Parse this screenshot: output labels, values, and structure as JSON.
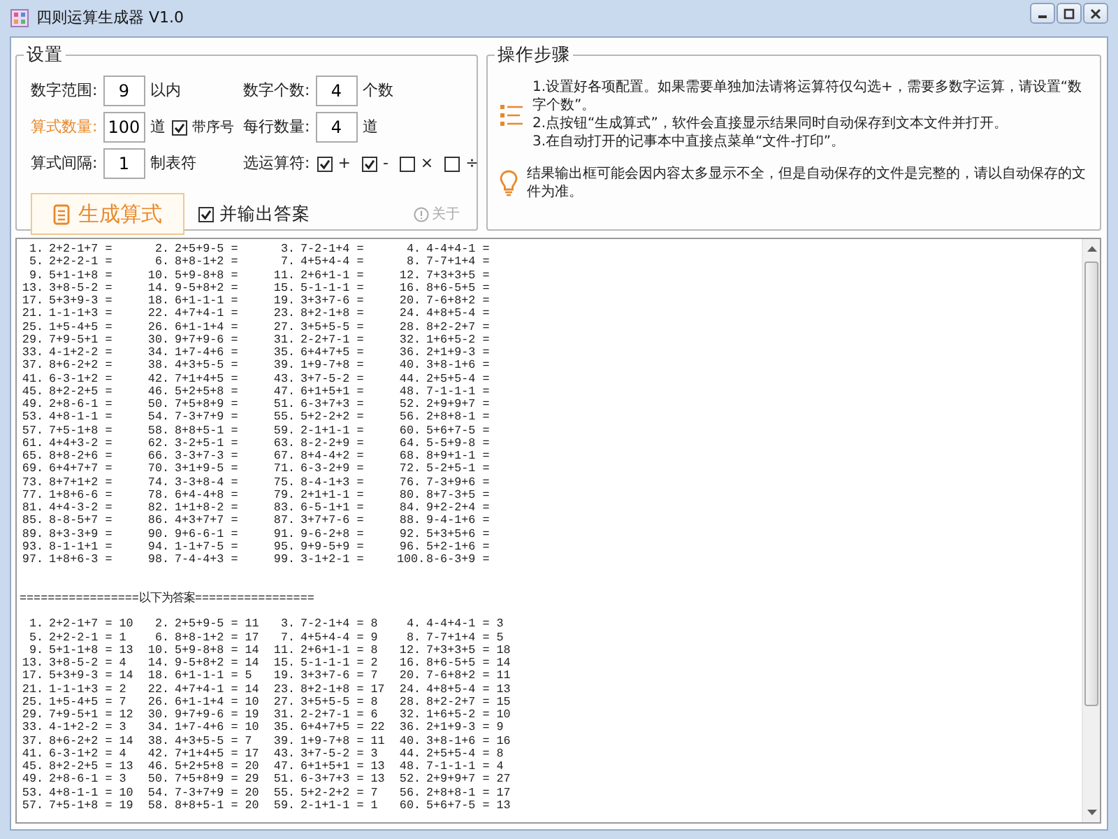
{
  "window": {
    "title": "四则运算生成器 V1.0"
  },
  "settings": {
    "title": "设置",
    "fields": [
      {
        "kind": "number",
        "label": "数字范围:",
        "value": "9",
        "unit": "以内",
        "highlighted": false
      },
      {
        "kind": "number",
        "label": "数字个数:",
        "value": "4",
        "unit": "个数",
        "highlighted": false
      },
      {
        "kind": "number",
        "label": "算式数量:",
        "value": "100",
        "unit": "道",
        "highlighted": true,
        "checkbox": {
          "label": "带序号",
          "checked": true
        }
      },
      {
        "kind": "number",
        "label": "每行数量:",
        "value": "4",
        "unit": "道",
        "highlighted": false
      },
      {
        "kind": "number",
        "label": "算式间隔:",
        "value": "1",
        "unit": "制表符",
        "highlighted": false
      },
      {
        "kind": "operators",
        "label": "选运算符:",
        "highlighted": false,
        "options": [
          {
            "symbol": "+",
            "checked": true
          },
          {
            "symbol": "-",
            "checked": true
          },
          {
            "symbol": "×",
            "checked": false
          },
          {
            "symbol": "÷",
            "checked": false
          }
        ]
      }
    ],
    "generate_button": "生成算式",
    "output_answers": {
      "label": "并输出答案",
      "checked": true
    },
    "about": "关于"
  },
  "steps": {
    "title": "操作步骤",
    "items": [
      "1.设置好各项配置。如果需要单独加法请将运算符仅勾选+，需要多数字运算，请设置“数字个数”。",
      "2.点按钮“生成算式”，软件会直接显示结果同时自动保存到文本文件并打开。",
      "3.在自动打开的记事本中直接点菜单“文件-打印”。"
    ],
    "tip": "结果输出框可能会因内容太多显示不全，但是自动保存的文件是完整的，请以自动保存的文件为准。"
  },
  "output": {
    "problems": [
      {
        "number": "1.",
        "expression": "2+2-1+7 ="
      },
      {
        "number": "2.",
        "expression": "2+5+9-5 ="
      },
      {
        "number": "3.",
        "expression": "7-2-1+4 ="
      },
      {
        "number": "4.",
        "expression": "4-4+4-1 ="
      },
      {
        "number": "5.",
        "expression": "2+2-2-1 ="
      },
      {
        "number": "6.",
        "expression": "8+8-1+2 ="
      },
      {
        "number": "7.",
        "expression": "4+5+4-4 ="
      },
      {
        "number": "8.",
        "expression": "7-7+1+4 ="
      },
      {
        "number": "9.",
        "expression": "5+1-1+8 ="
      },
      {
        "number": "10.",
        "expression": "5+9-8+8 ="
      },
      {
        "number": "11.",
        "expression": "2+6+1-1 ="
      },
      {
        "number": "12.",
        "expression": "7+3+3+5 ="
      },
      {
        "number": "13.",
        "expression": "3+8-5-2 ="
      },
      {
        "number": "14.",
        "expression": "9-5+8+2 ="
      },
      {
        "number": "15.",
        "expression": "5-1-1-1 ="
      },
      {
        "number": "16.",
        "expression": "8+6-5+5 ="
      },
      {
        "number": "17.",
        "expression": "5+3+9-3 ="
      },
      {
        "number": "18.",
        "expression": "6+1-1-1 ="
      },
      {
        "number": "19.",
        "expression": "3+3+7-6 ="
      },
      {
        "number": "20.",
        "expression": "7-6+8+2 ="
      },
      {
        "number": "21.",
        "expression": "1-1-1+3 ="
      },
      {
        "number": "22.",
        "expression": "4+7+4-1 ="
      },
      {
        "number": "23.",
        "expression": "8+2-1+8 ="
      },
      {
        "number": "24.",
        "expression": "4+8+5-4 ="
      },
      {
        "number": "25.",
        "expression": "1+5-4+5 ="
      },
      {
        "number": "26.",
        "expression": "6+1-1+4 ="
      },
      {
        "number": "27.",
        "expression": "3+5+5-5 ="
      },
      {
        "number": "28.",
        "expression": "8+2-2+7 ="
      },
      {
        "number": "29.",
        "expression": "7+9-5+1 ="
      },
      {
        "number": "30.",
        "expression": "9+7+9-6 ="
      },
      {
        "number": "31.",
        "expression": "2-2+7-1 ="
      },
      {
        "number": "32.",
        "expression": "1+6+5-2 ="
      },
      {
        "number": "33.",
        "expression": "4-1+2-2 ="
      },
      {
        "number": "34.",
        "expression": "1+7-4+6 ="
      },
      {
        "number": "35.",
        "expression": "6+4+7+5 ="
      },
      {
        "number": "36.",
        "expression": "2+1+9-3 ="
      },
      {
        "number": "37.",
        "expression": "8+6-2+2 ="
      },
      {
        "number": "38.",
        "expression": "4+3+5-5 ="
      },
      {
        "number": "39.",
        "expression": "1+9-7+8 ="
      },
      {
        "number": "40.",
        "expression": "3+8-1+6 ="
      },
      {
        "number": "41.",
        "expression": "6-3-1+2 ="
      },
      {
        "number": "42.",
        "expression": "7+1+4+5 ="
      },
      {
        "number": "43.",
        "expression": "3+7-5-2 ="
      },
      {
        "number": "44.",
        "expression": "2+5+5-4 ="
      },
      {
        "number": "45.",
        "expression": "8+2-2+5 ="
      },
      {
        "number": "46.",
        "expression": "5+2+5+8 ="
      },
      {
        "number": "47.",
        "expression": "6+1+5+1 ="
      },
      {
        "number": "48.",
        "expression": "7-1-1-1 ="
      },
      {
        "number": "49.",
        "expression": "2+8-6-1 ="
      },
      {
        "number": "50.",
        "expression": "7+5+8+9 ="
      },
      {
        "number": "51.",
        "expression": "6-3+7+3 ="
      },
      {
        "number": "52.",
        "expression": "2+9+9+7 ="
      },
      {
        "number": "53.",
        "expression": "4+8-1-1 ="
      },
      {
        "number": "54.",
        "expression": "7-3+7+9 ="
      },
      {
        "number": "55.",
        "expression": "5+2-2+2 ="
      },
      {
        "number": "56.",
        "expression": "2+8+8-1 ="
      },
      {
        "number": "57.",
        "expression": "7+5-1+8 ="
      },
      {
        "number": "58.",
        "expression": "8+8+5-1 ="
      },
      {
        "number": "59.",
        "expression": "2-1+1-1 ="
      },
      {
        "number": "60.",
        "expression": "5+6+7-5 ="
      },
      {
        "number": "61.",
        "expression": "4+4+3-2 ="
      },
      {
        "number": "62.",
        "expression": "3-2+5-1 ="
      },
      {
        "number": "63.",
        "expression": "8-2-2+9 ="
      },
      {
        "number": "64.",
        "expression": "5-5+9-8 ="
      },
      {
        "number": "65.",
        "expression": "8+8-2+6 ="
      },
      {
        "number": "66.",
        "expression": "3-3+7-3 ="
      },
      {
        "number": "67.",
        "expression": "8+4-4+2 ="
      },
      {
        "number": "68.",
        "expression": "8+9+1-1 ="
      },
      {
        "number": "69.",
        "expression": "6+4+7+7 ="
      },
      {
        "number": "70.",
        "expression": "3+1+9-5 ="
      },
      {
        "number": "71.",
        "expression": "6-3-2+9 ="
      },
      {
        "number": "72.",
        "expression": "5-2+5-1 ="
      },
      {
        "number": "73.",
        "expression": "8+7+1+2 ="
      },
      {
        "number": "74.",
        "expression": "3-3+8-4 ="
      },
      {
        "number": "75.",
        "expression": "8-4-1+3 ="
      },
      {
        "number": "76.",
        "expression": "7-3+9+6 ="
      },
      {
        "number": "77.",
        "expression": "1+8+6-6 ="
      },
      {
        "number": "78.",
        "expression": "6+4-4+8 ="
      },
      {
        "number": "79.",
        "expression": "2+1+1-1 ="
      },
      {
        "number": "80.",
        "expression": "8+7-3+5 ="
      },
      {
        "number": "81.",
        "expression": "4+4-3-2 ="
      },
      {
        "number": "82.",
        "expression": "1+1+8-2 ="
      },
      {
        "number": "83.",
        "expression": "6-5-1+1 ="
      },
      {
        "number": "84.",
        "expression": "9+2-2+4 ="
      },
      {
        "number": "85.",
        "expression": "8-8-5+7 ="
      },
      {
        "number": "86.",
        "expression": "4+3+7+7 ="
      },
      {
        "number": "87.",
        "expression": "3+7+7-6 ="
      },
      {
        "number": "88.",
        "expression": "9-4-1+6 ="
      },
      {
        "number": "89.",
        "expression": "8+3-3+9 ="
      },
      {
        "number": "90.",
        "expression": "9+6-6-1 ="
      },
      {
        "number": "91.",
        "expression": "9-6-2+8 ="
      },
      {
        "number": "92.",
        "expression": "5+3+5+6 ="
      },
      {
        "number": "93.",
        "expression": "8-1-1+1 ="
      },
      {
        "number": "94.",
        "expression": "1-1+7-5 ="
      },
      {
        "number": "95.",
        "expression": "9+9-5+9 ="
      },
      {
        "number": "96.",
        "expression": "5+2-1+6 ="
      },
      {
        "number": "97.",
        "expression": "1+8+6-3 ="
      },
      {
        "number": "98.",
        "expression": "7-4-4+3 ="
      },
      {
        "number": "99.",
        "expression": "3-1+2-1 ="
      },
      {
        "number": "100.",
        "expression": "8-6-3+9 ="
      }
    ],
    "separator": "=================以下为答案=================",
    "answers": [
      {
        "number": "1.",
        "expression": "2+2-1+7 = 10"
      },
      {
        "number": "2.",
        "expression": "2+5+9-5 = 11"
      },
      {
        "number": "3.",
        "expression": "7-2-1+4 = 8"
      },
      {
        "number": "4.",
        "expression": "4-4+4-1 = 3"
      },
      {
        "number": "5.",
        "expression": "2+2-2-1 = 1"
      },
      {
        "number": "6.",
        "expression": "8+8-1+2 = 17"
      },
      {
        "number": "7.",
        "expression": "4+5+4-4 = 9"
      },
      {
        "number": "8.",
        "expression": "7-7+1+4 = 5"
      },
      {
        "number": "9.",
        "expression": "5+1-1+8 = 13"
      },
      {
        "number": "10.",
        "expression": "5+9-8+8 = 14"
      },
      {
        "number": "11.",
        "expression": "2+6+1-1 = 8"
      },
      {
        "number": "12.",
        "expression": "7+3+3+5 = 18"
      },
      {
        "number": "13.",
        "expression": "3+8-5-2 = 4"
      },
      {
        "number": "14.",
        "expression": "9-5+8+2 = 14"
      },
      {
        "number": "15.",
        "expression": "5-1-1-1 = 2"
      },
      {
        "number": "16.",
        "expression": "8+6-5+5 = 14"
      },
      {
        "number": "17.",
        "expression": "5+3+9-3 = 14"
      },
      {
        "number": "18.",
        "expression": "6+1-1-1 = 5"
      },
      {
        "number": "19.",
        "expression": "3+3+7-6 = 7"
      },
      {
        "number": "20.",
        "expression": "7-6+8+2 = 11"
      },
      {
        "number": "21.",
        "expression": "1-1-1+3 = 2"
      },
      {
        "number": "22.",
        "expression": "4+7+4-1 = 14"
      },
      {
        "number": "23.",
        "expression": "8+2-1+8 = 17"
      },
      {
        "number": "24.",
        "expression": "4+8+5-4 = 13"
      },
      {
        "number": "25.",
        "expression": "1+5-4+5 = 7"
      },
      {
        "number": "26.",
        "expression": "6+1-1+4 = 10"
      },
      {
        "number": "27.",
        "expression": "3+5+5-5 = 8"
      },
      {
        "number": "28.",
        "expression": "8+2-2+7 = 15"
      },
      {
        "number": "29.",
        "expression": "7+9-5+1 = 12"
      },
      {
        "number": "30.",
        "expression": "9+7+9-6 = 19"
      },
      {
        "number": "31.",
        "expression": "2-2+7-1 = 6"
      },
      {
        "number": "32.",
        "expression": "1+6+5-2 = 10"
      },
      {
        "number": "33.",
        "expression": "4-1+2-2 = 3"
      },
      {
        "number": "34.",
        "expression": "1+7-4+6 = 10"
      },
      {
        "number": "35.",
        "expression": "6+4+7+5 = 22"
      },
      {
        "number": "36.",
        "expression": "2+1+9-3 = 9"
      },
      {
        "number": "37.",
        "expression": "8+6-2+2 = 14"
      },
      {
        "number": "38.",
        "expression": "4+3+5-5 = 7"
      },
      {
        "number": "39.",
        "expression": "1+9-7+8 = 11"
      },
      {
        "number": "40.",
        "expression": "3+8-1+6 = 16"
      },
      {
        "number": "41.",
        "expression": "6-3-1+2 = 4"
      },
      {
        "number": "42.",
        "expression": "7+1+4+5 = 17"
      },
      {
        "number": "43.",
        "expression": "3+7-5-2 = 3"
      },
      {
        "number": "44.",
        "expression": "2+5+5-4 = 8"
      },
      {
        "number": "45.",
        "expression": "8+2-2+5 = 13"
      },
      {
        "number": "46.",
        "expression": "5+2+5+8 = 20"
      },
      {
        "number": "47.",
        "expression": "6+1+5+1 = 13"
      },
      {
        "number": "48.",
        "expression": "7-1-1-1 = 4"
      },
      {
        "number": "49.",
        "expression": "2+8-6-1 = 3"
      },
      {
        "number": "50.",
        "expression": "7+5+8+9 = 29"
      },
      {
        "number": "51.",
        "expression": "6-3+7+3 = 13"
      },
      {
        "number": "52.",
        "expression": "2+9+9+7 = 27"
      },
      {
        "number": "53.",
        "expression": "4+8-1-1 = 10"
      },
      {
        "number": "54.",
        "expression": "7-3+7+9 = 20"
      },
      {
        "number": "55.",
        "expression": "5+2-2+2 = 7"
      },
      {
        "number": "56.",
        "expression": "2+8+8-1 = 17"
      },
      {
        "number": "57.",
        "expression": "7+5-1+8 = 19"
      },
      {
        "number": "58.",
        "expression": "8+8+5-1 = 20"
      },
      {
        "number": "59.",
        "expression": "2-1+1-1 = 1"
      },
      {
        "number": "60.",
        "expression": "5+6+7-5 = 13"
      }
    ]
  }
}
